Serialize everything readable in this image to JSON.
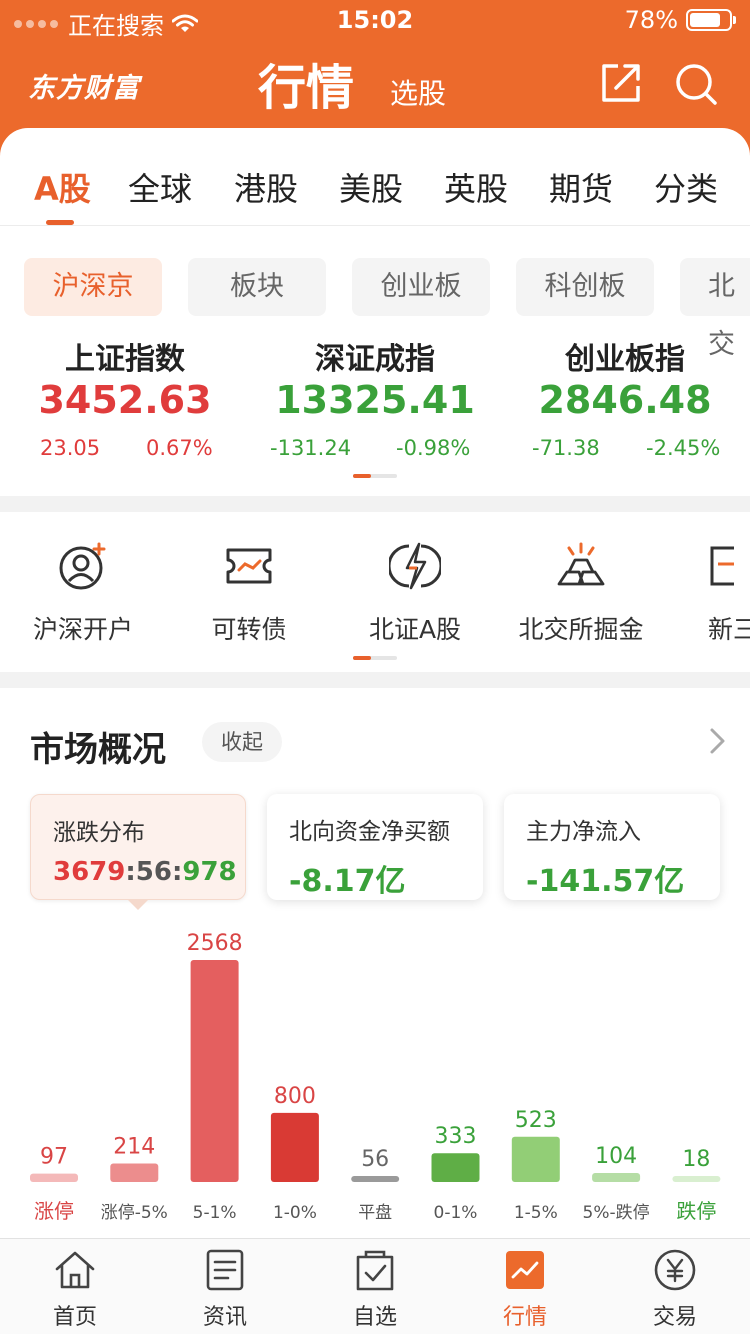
{
  "status_bar": {
    "carrier": "正在搜索",
    "time": "15:02",
    "battery": "78%"
  },
  "header": {
    "brand": "东方财富",
    "title": "行情",
    "subtitle": "选股"
  },
  "main_tabs": [
    "A股",
    "全球",
    "港股",
    "美股",
    "英股",
    "期货",
    "分类"
  ],
  "sub_tabs": [
    "沪深京",
    "板块",
    "创业板",
    "科创板",
    "北交"
  ],
  "indices": [
    {
      "name": "上证指数",
      "value": "3452.63",
      "change": "23.05",
      "pct": "0.67%",
      "trend": "up"
    },
    {
      "name": "深证成指",
      "value": "13325.41",
      "change": "-131.24",
      "pct": "-0.98%",
      "trend": "down"
    },
    {
      "name": "创业板指",
      "value": "2846.48",
      "change": "-71.38",
      "pct": "-2.45%",
      "trend": "down"
    }
  ],
  "quick_entries": [
    {
      "label": "沪深开户",
      "icon": "user-plus-icon"
    },
    {
      "label": "可转债",
      "icon": "bond-ticket-icon"
    },
    {
      "label": "北证A股",
      "icon": "lightning-globe-icon"
    },
    {
      "label": "北交所掘金",
      "icon": "gold-bars-icon"
    },
    {
      "label": "新三",
      "icon": "board-icon"
    }
  ],
  "market": {
    "title": "市场概况",
    "collapse_label": "收起",
    "distribution": {
      "label": "涨跌分布",
      "up": "3679",
      "flat": "56",
      "down": "978",
      "sep": ":"
    },
    "northbound": {
      "label": "北向资金净买额",
      "value": "-8.17亿"
    },
    "main_flow": {
      "label": "主力净流入",
      "value": "-141.57亿"
    }
  },
  "chart_data": {
    "type": "bar",
    "categories": [
      "涨停",
      "涨停-5%",
      "5-1%",
      "1-0%",
      "平盘",
      "0-1%",
      "1-5%",
      "5%-跌停",
      "跌停"
    ],
    "values": [
      97,
      214,
      2568,
      800,
      56,
      333,
      523,
      104,
      18
    ],
    "colors": [
      "#f4b9b9",
      "#ec8d8d",
      "#e45f5f",
      "#d93a34",
      "#9a9a9a",
      "#5fae46",
      "#92ce76",
      "#b5dda5",
      "#d9efd0"
    ],
    "label_colors": [
      "#d94545",
      "#d94545",
      "#d94545",
      "#d94545",
      "#666666",
      "#3aa13a",
      "#3aa13a",
      "#3aa13a",
      "#3aa13a"
    ],
    "category_colors": [
      "#d94545",
      "#555555",
      "#555555",
      "#555555",
      "#555555",
      "#555555",
      "#555555",
      "#555555",
      "#3aa13a"
    ]
  },
  "bottom_nav": [
    {
      "label": "首页",
      "icon": "home-icon"
    },
    {
      "label": "资讯",
      "icon": "news-icon"
    },
    {
      "label": "自选",
      "icon": "watchlist-icon"
    },
    {
      "label": "行情",
      "icon": "market-chart-icon",
      "active": true
    },
    {
      "label": "交易",
      "icon": "yen-trade-icon"
    }
  ],
  "colors": {
    "accent": "#ec6a2c",
    "up": "#e03c3c",
    "down": "#3aa13a"
  }
}
